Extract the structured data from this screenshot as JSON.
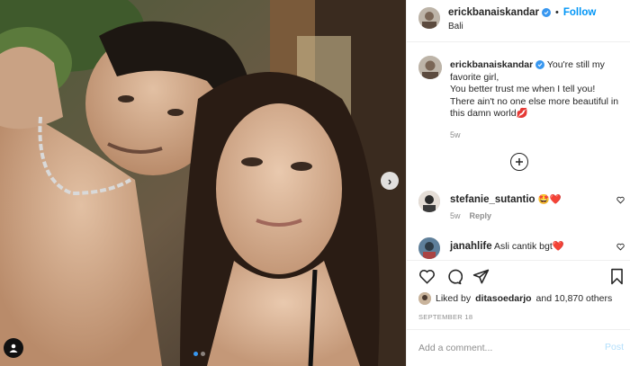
{
  "header": {
    "username": "erickbanaiskandar",
    "separator": "•",
    "follow_label": "Follow",
    "location": "Bali"
  },
  "caption": {
    "username": "erickbanaiskandar",
    "text": "You're still my favorite girl,",
    "line2": "You better trust me when I tell you!",
    "line3": "There ain't no one else more beautiful in this damn world",
    "emoji": "💋",
    "timestamp": "5w"
  },
  "comments": [
    {
      "username": "stefanie_sutantio",
      "text": "🤩❤️",
      "timestamp": "5w",
      "reply_label": "Reply"
    },
    {
      "username": "janahlife",
      "text": "Asli cantik bgt❤️"
    }
  ],
  "likes": {
    "prefix": "Liked by",
    "liker": "ditasoedarjo",
    "suffix": "and 10,870 others"
  },
  "date": "SEPTEMBER 18",
  "add_comment": {
    "placeholder": "Add a comment...",
    "post_label": "Post"
  },
  "carousel": {
    "count": 2,
    "active_index": 0
  },
  "colors": {
    "accent": "#0095f6",
    "verified": "#3897f0",
    "text": "#262626",
    "muted": "#8e8e8e"
  },
  "icons": [
    "chevron-right-icon",
    "user-tag-icon",
    "verified-icon",
    "plus-circle-icon",
    "heart-icon",
    "comment-icon",
    "share-icon",
    "bookmark-icon"
  ]
}
